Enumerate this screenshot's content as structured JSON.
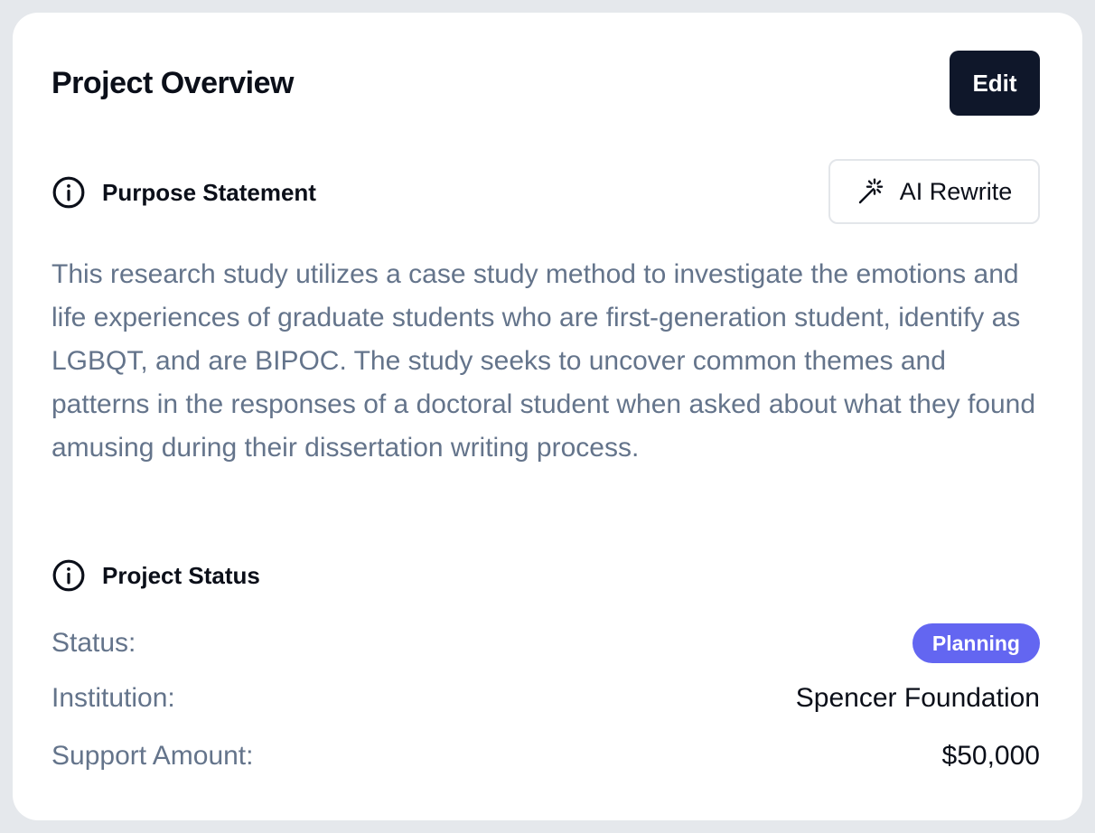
{
  "header": {
    "title": "Project Overview",
    "edit_label": "Edit"
  },
  "purpose": {
    "heading": "Purpose Statement",
    "icon": "info-icon",
    "ai_rewrite_label": "AI Rewrite",
    "ai_rewrite_icon": "magic-wand-icon",
    "text": "This research study utilizes a case study method to investigate the emotions and life experiences of graduate students who are first-generation student, identify as LGBQT, and are BIPOC. The study seeks to uncover common themes and patterns in the responses of a doctoral student when asked about what they found amusing during their dissertation writing process."
  },
  "status": {
    "heading": "Project Status",
    "icon": "info-icon",
    "rows": [
      {
        "label": "Status:",
        "value": "Planning",
        "kind": "badge"
      },
      {
        "label": "Institution:",
        "value": "Spencer Foundation"
      },
      {
        "label": "Support Amount:",
        "value": "$50,000"
      }
    ]
  },
  "colors": {
    "primary_button": "#0f172a",
    "badge": "#6366f1",
    "muted_text": "#64748b",
    "text": "#0b0f19"
  }
}
